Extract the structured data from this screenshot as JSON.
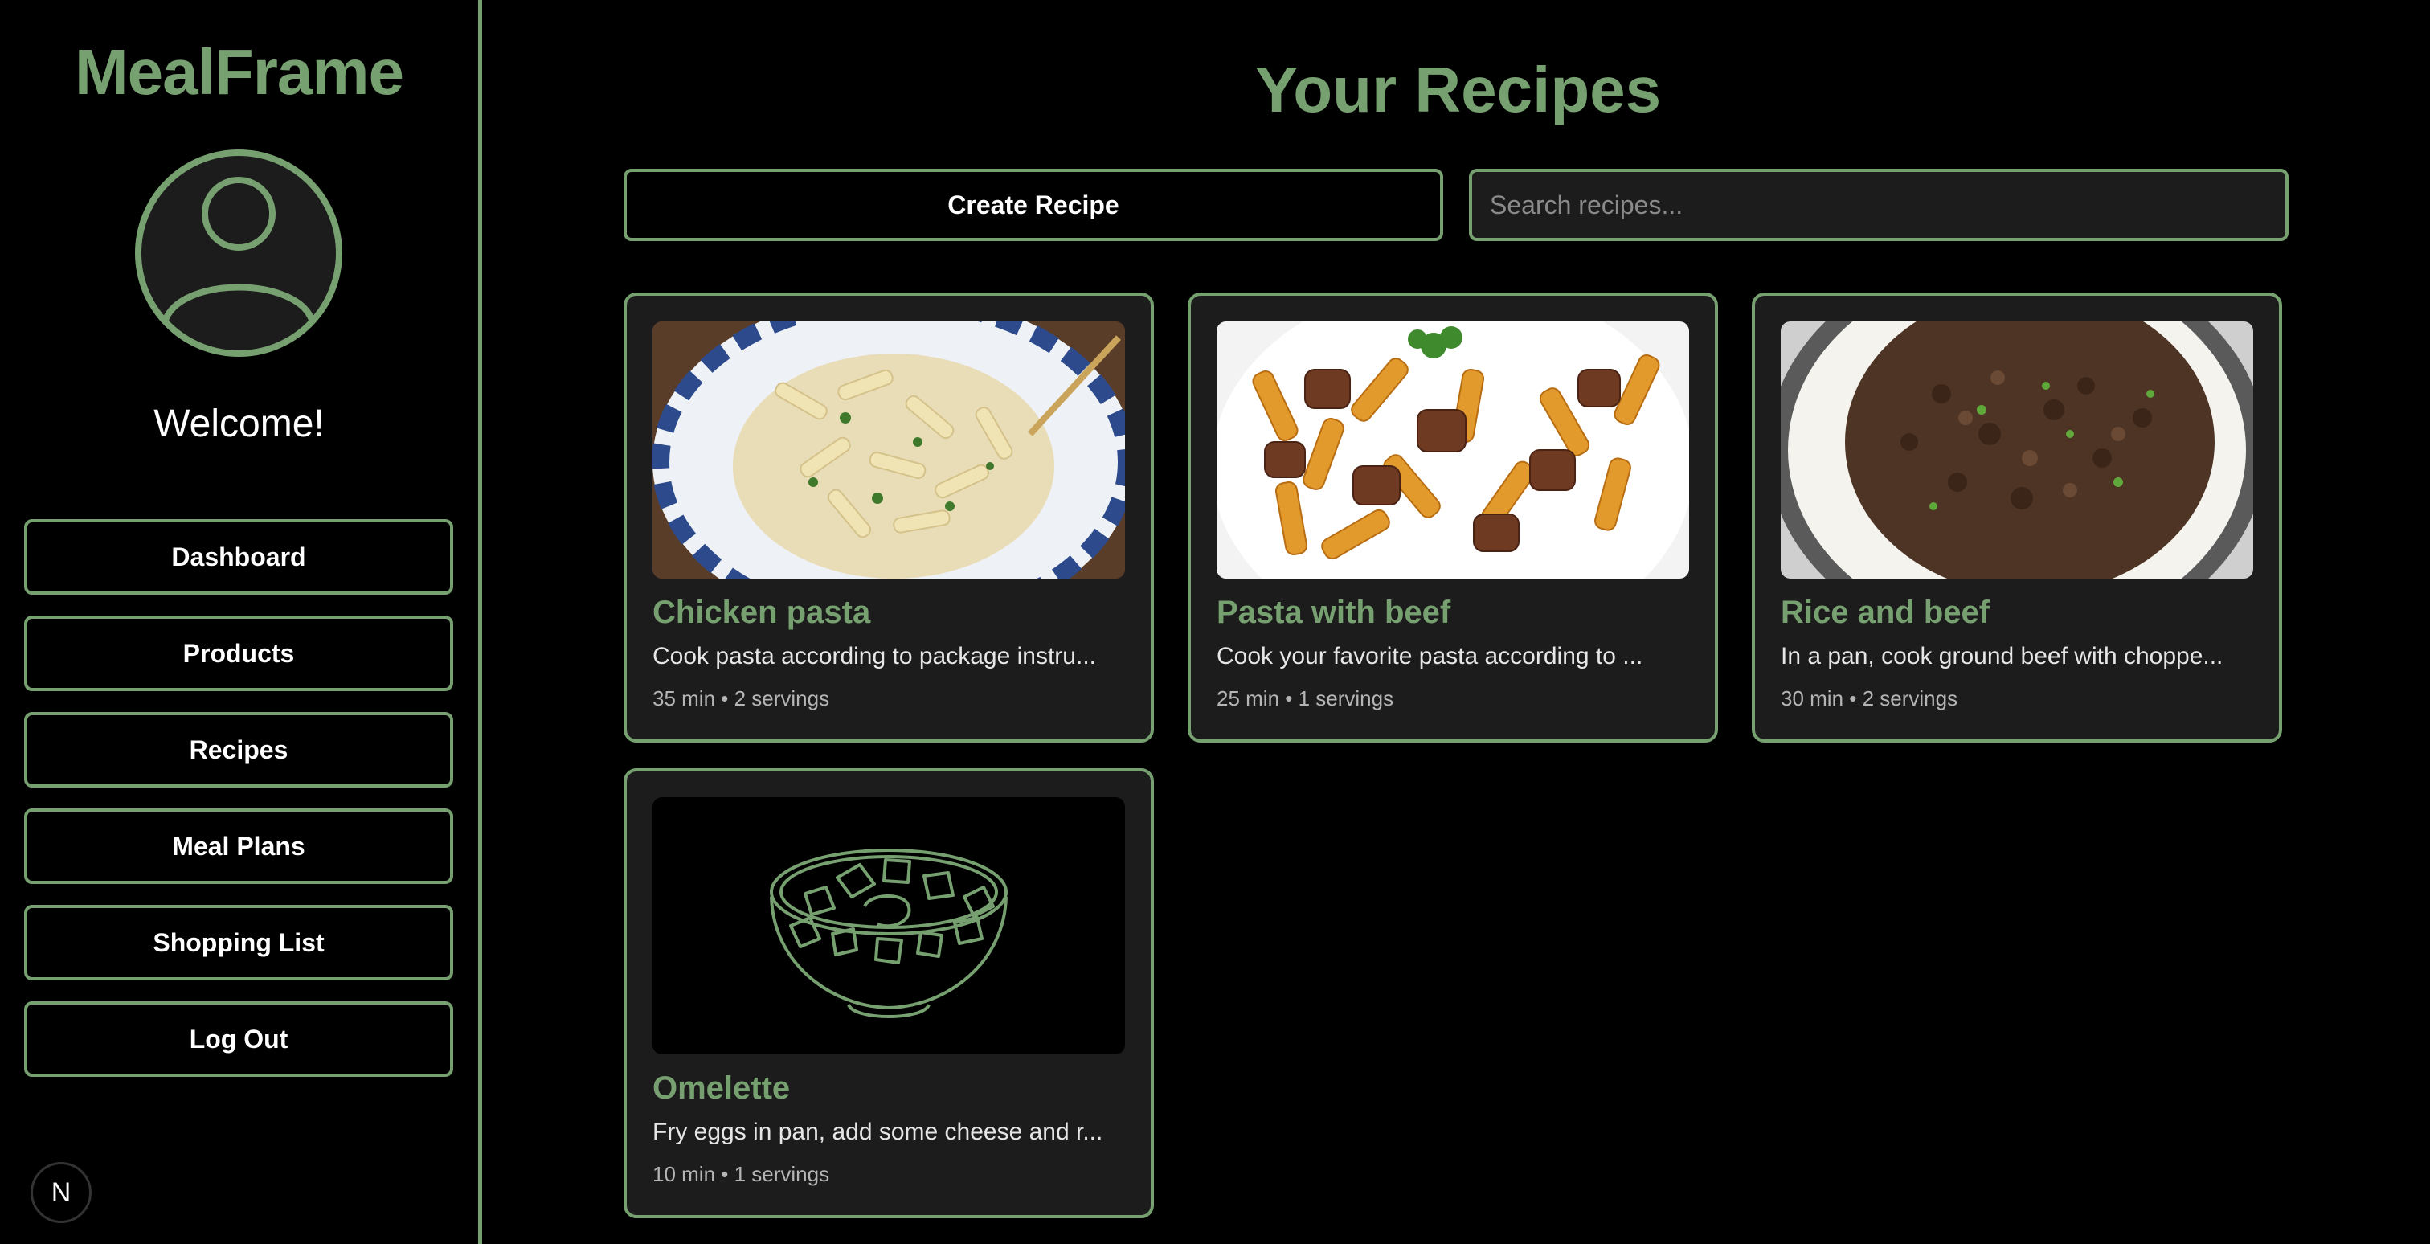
{
  "sidebar": {
    "brand": "MealFrame",
    "welcome": "Welcome!",
    "nav": [
      {
        "label": "Dashboard"
      },
      {
        "label": "Products"
      },
      {
        "label": "Recipes"
      },
      {
        "label": "Meal Plans"
      },
      {
        "label": "Shopping List"
      },
      {
        "label": "Log Out"
      }
    ],
    "badge": "N"
  },
  "main": {
    "title": "Your Recipes",
    "create_label": "Create Recipe",
    "search_placeholder": "Search recipes...",
    "recipes": [
      {
        "name": "Chicken pasta",
        "desc": "Cook pasta according to package instru...",
        "meta": "35 min • 2 servings",
        "image": "chicken-pasta-photo"
      },
      {
        "name": "Pasta with beef",
        "desc": "Cook your favorite pasta according to ...",
        "meta": "25 min • 1 servings",
        "image": "pasta-beef-photo"
      },
      {
        "name": "Rice and beef",
        "desc": "In a pan, cook ground beef with choppe...",
        "meta": "30 min • 2 servings",
        "image": "rice-beef-photo"
      },
      {
        "name": "Omelette",
        "desc": "Fry eggs in pan, add some cheese and r...",
        "meta": "10 min • 1 servings",
        "image": "bowl-icon"
      }
    ]
  },
  "colors": {
    "accent": "#76a06f",
    "card_bg": "#1c1c1c",
    "background": "#000000"
  }
}
